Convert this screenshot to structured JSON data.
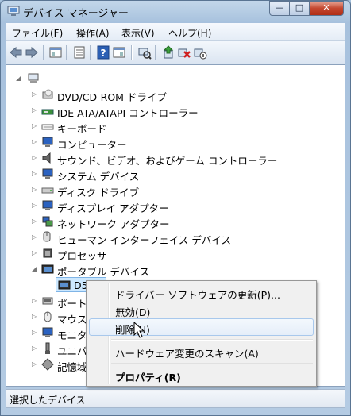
{
  "window": {
    "title": "デバイス マネージャー",
    "controls": {
      "minimize": "—",
      "maximize": "□",
      "close": "✕"
    }
  },
  "menubar": {
    "items": [
      "ファイル(F)",
      "操作(A)",
      "表示(V)",
      "ヘルプ(H)"
    ]
  },
  "toolbar": {
    "icons": [
      "back-icon",
      "forward-icon",
      "properties-view-icon",
      "details-icon",
      "help-icon",
      "show-hide-icon",
      "scan-icon",
      "update-driver-icon",
      "uninstall-icon",
      "disable-icon"
    ]
  },
  "tree": {
    "root_label": "",
    "categories": [
      "DVD/CD-ROM ドライブ",
      "IDE ATA/ATAPI コントローラー",
      "キーボード",
      "コンピューター",
      "サウンド、ビデオ、およびゲーム コントローラー",
      "システム デバイス",
      "ディスク ドライブ",
      "ディスプレイ アダプター",
      "ネットワーク アダプター",
      "ヒューマン インターフェイス デバイス",
      "プロセッサ",
      "ポータブル デバイス"
    ],
    "selected_child": "D5120",
    "after_categories": [
      "ポート",
      "マウス",
      "モニタ",
      "ユニバ",
      "記憶域"
    ]
  },
  "context_menu": {
    "items": [
      "ドライバー ソフトウェアの更新(P)...",
      "無効(D)",
      "削除(U)",
      "ハードウェア変更のスキャン(A)",
      "プロパティ(R)"
    ]
  },
  "statusbar": {
    "text": "選択したデバイス"
  },
  "colors": {
    "accent": "#3399ff",
    "selection": "#cce8ff",
    "hover_border": "#a8c8ec"
  }
}
